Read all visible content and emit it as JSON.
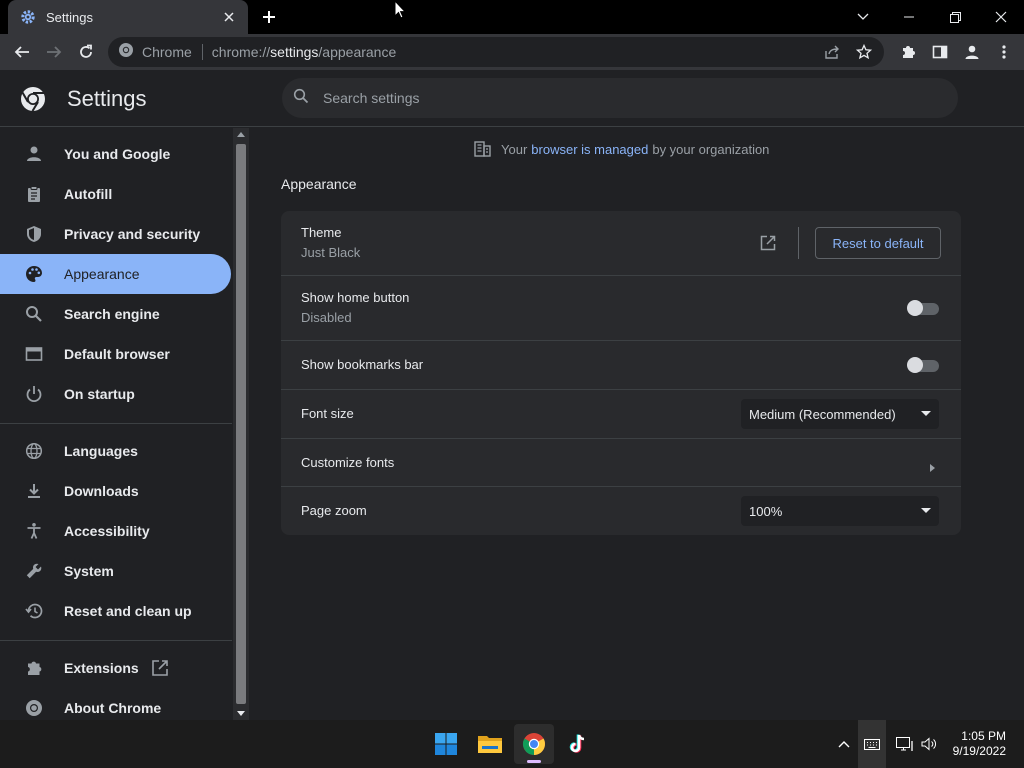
{
  "browser": {
    "tab_title": "Settings",
    "site_chip": "Chrome",
    "url_prefix": "chrome://",
    "url_host": "settings",
    "url_path": "/appearance",
    "colors": {
      "accent": "#8ab4f8",
      "background": "#202124",
      "card": "#292a2d"
    }
  },
  "header": {
    "title": "Settings",
    "search_placeholder": "Search settings"
  },
  "sidebar": {
    "items": [
      {
        "label": "You and Google",
        "icon": "person-icon"
      },
      {
        "label": "Autofill",
        "icon": "clipboard-icon"
      },
      {
        "label": "Privacy and security",
        "icon": "shield-icon"
      },
      {
        "label": "Appearance",
        "icon": "palette-icon",
        "active": true
      },
      {
        "label": "Search engine",
        "icon": "search-icon"
      },
      {
        "label": "Default browser",
        "icon": "browser-window-icon"
      },
      {
        "label": "On startup",
        "icon": "power-icon"
      },
      {
        "label": "Languages",
        "icon": "globe-icon"
      },
      {
        "label": "Downloads",
        "icon": "download-icon"
      },
      {
        "label": "Accessibility",
        "icon": "accessibility-icon"
      },
      {
        "label": "System",
        "icon": "wrench-icon"
      },
      {
        "label": "Reset and clean up",
        "icon": "history-icon"
      },
      {
        "label": "Extensions",
        "icon": "puzzle-icon"
      },
      {
        "label": "About Chrome",
        "icon": "chrome-icon"
      }
    ]
  },
  "managed_notice": {
    "prefix": "Your",
    "link": "browser is managed",
    "suffix": "by your organization"
  },
  "appearance": {
    "section_title": "Appearance",
    "theme": {
      "label": "Theme",
      "value": "Just Black",
      "reset_label": "Reset to default"
    },
    "home_button": {
      "label": "Show home button",
      "status": "Disabled",
      "enabled": false
    },
    "bookmarks_bar": {
      "label": "Show bookmarks bar",
      "enabled": false
    },
    "font_size": {
      "label": "Font size",
      "selected": "Medium (Recommended)"
    },
    "customize_fonts": {
      "label": "Customize fonts"
    },
    "page_zoom": {
      "label": "Page zoom",
      "selected": "100%"
    }
  },
  "taskbar": {
    "apps": [
      "windows-start-icon",
      "file-explorer-icon",
      "chrome-icon",
      "tiktok-icon"
    ],
    "time": "1:05 PM",
    "date": "9/19/2022"
  }
}
